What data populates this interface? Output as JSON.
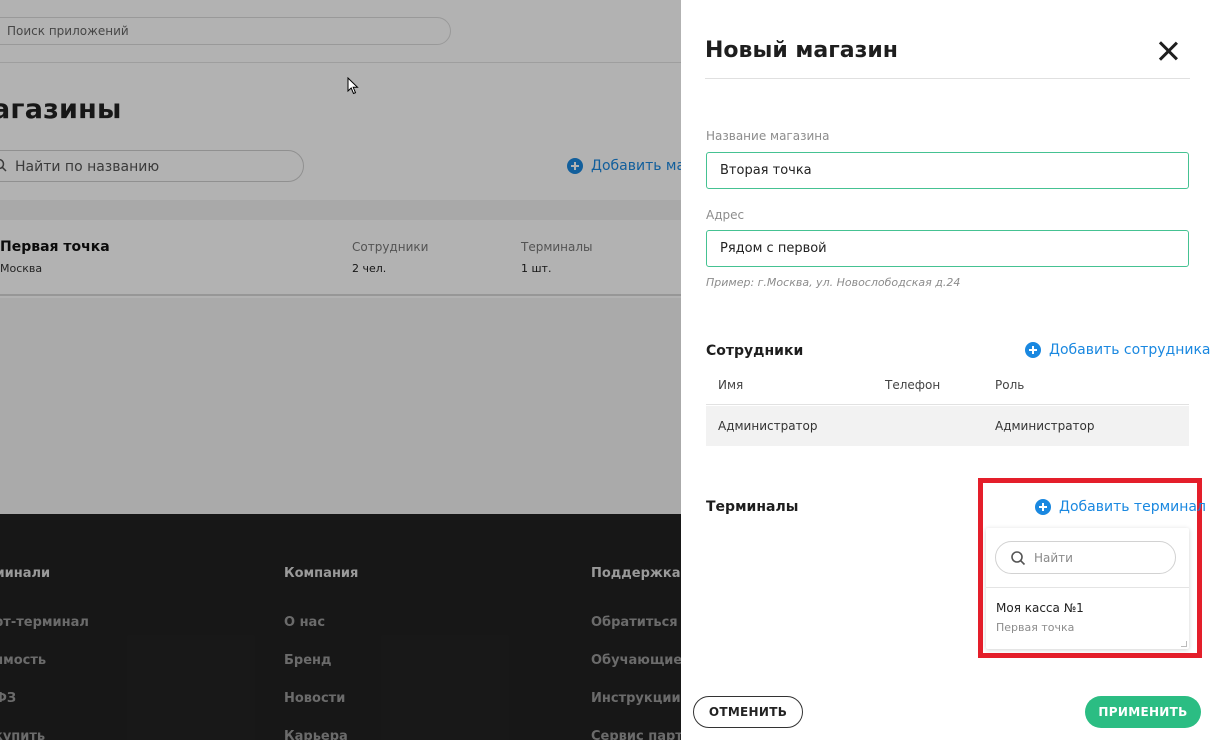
{
  "background": {
    "app_search_placeholder": "Поиск приложений",
    "page_title": "агазины",
    "shop_search_placeholder": "Найти по названию",
    "add_shop_label": "Добавить маг",
    "shop": {
      "name": "Первая точка",
      "city": "Москва",
      "employees_label": "Сотрудники",
      "employees_value": "2 чел.",
      "terminals_label": "Терминалы",
      "terminals_value": "1 шт."
    },
    "footer": {
      "col1": {
        "heading": "минали",
        "items": [
          "рт-терминал",
          "имость",
          "ФЗ",
          "купить"
        ]
      },
      "col2": {
        "heading": "Компания",
        "items": [
          "О нас",
          "Бренд",
          "Новости",
          "Карьера"
        ]
      },
      "col3": {
        "heading": "Поддержка",
        "items": [
          "Обратиться в",
          "Обучающие м",
          "Инструкции",
          "Сервис партне"
        ]
      }
    }
  },
  "panel": {
    "title": "Новый магазин",
    "shop_name": {
      "label": "Название магазина",
      "value": "Вторая точка"
    },
    "address": {
      "label": "Адрес",
      "value": "Рядом с первой",
      "hint": "Пример: г.Москва, ул. Новослободская д.24"
    },
    "employees": {
      "heading": "Сотрудники",
      "add_label": "Добавить сотрудника",
      "columns": {
        "name": "Имя",
        "phone": "Телефон",
        "role": "Роль"
      },
      "rows": [
        {
          "name": "Администратор",
          "phone": "",
          "role": "Администратор"
        }
      ]
    },
    "terminals": {
      "heading": "Терминалы",
      "add_label": "Добавить терминал",
      "dropdown": {
        "search_placeholder": "Найти",
        "items": [
          {
            "name": "Моя касса №1",
            "shop": "Первая точка"
          }
        ]
      }
    },
    "cancel_label": "ОТМЕНИТЬ",
    "apply_label": "ПРИМЕНИТЬ"
  },
  "colors": {
    "accent_blue": "#1a88e0",
    "input_border_green": "#45c292",
    "apply_green": "#2bbd83",
    "highlight_red": "#e41e2a",
    "footer_dark": "#222222"
  }
}
